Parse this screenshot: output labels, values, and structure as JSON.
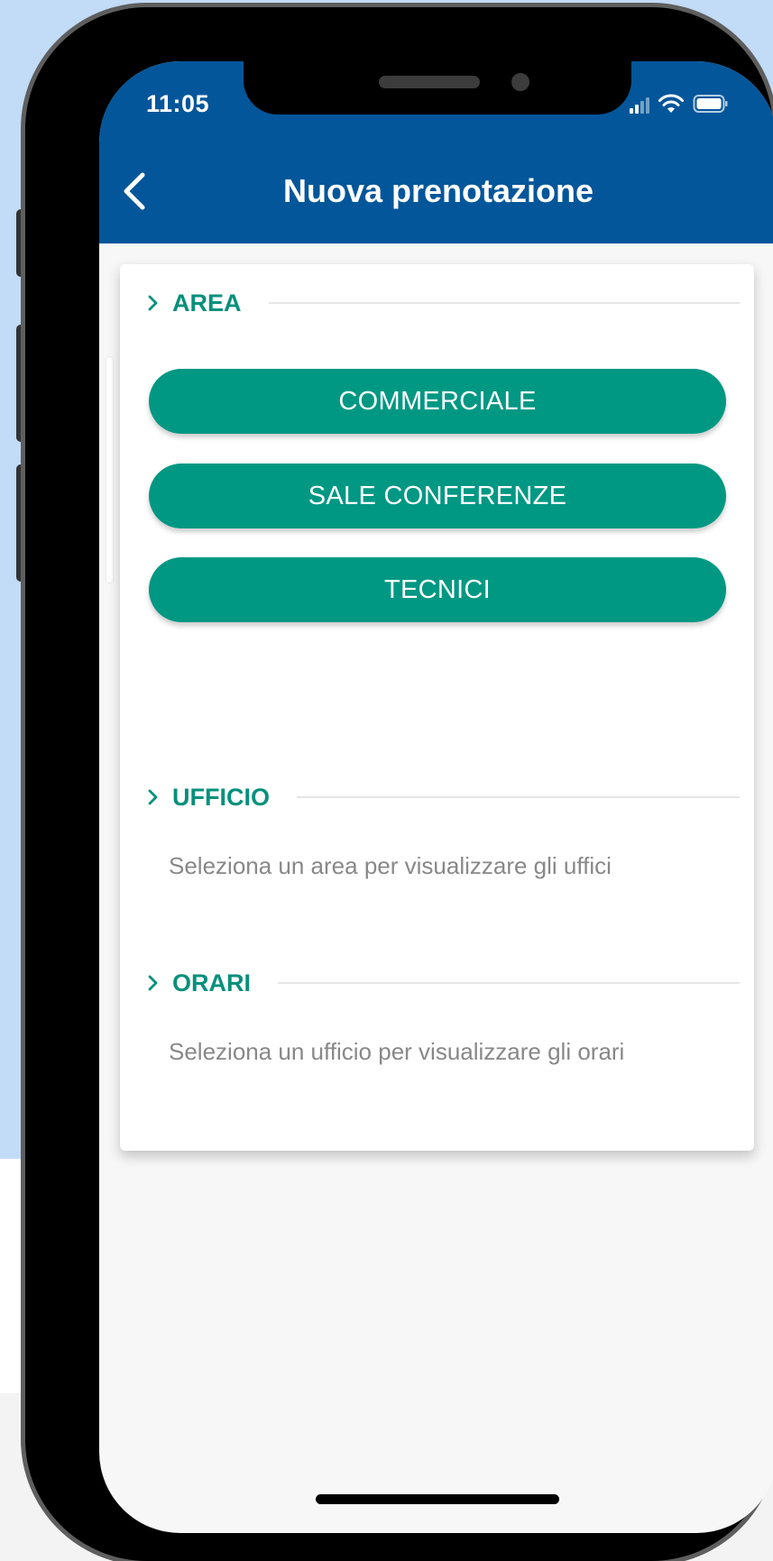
{
  "status_bar": {
    "time": "11:05",
    "icons": [
      "signal-icon",
      "wifi-icon",
      "battery-icon"
    ]
  },
  "header": {
    "title": "Nuova prenotazione",
    "back_icon": "chevron-left-icon"
  },
  "sections": {
    "area": {
      "title": "AREA",
      "buttons": [
        "COMMERCIALE",
        "SALE CONFERENZE",
        "TECNICI"
      ]
    },
    "ufficio": {
      "title": "UFFICIO",
      "hint": "Seleziona un area per visualizzare gli uffici"
    },
    "orari": {
      "title": "ORARI",
      "hint": "Seleziona un ufficio per visualizzare gli orari"
    }
  },
  "colors": {
    "header_bg": "#03569a",
    "accent": "#009883",
    "section_title": "#05907b",
    "hint_text": "#888888",
    "backdrop": "#c2dbf6"
  }
}
